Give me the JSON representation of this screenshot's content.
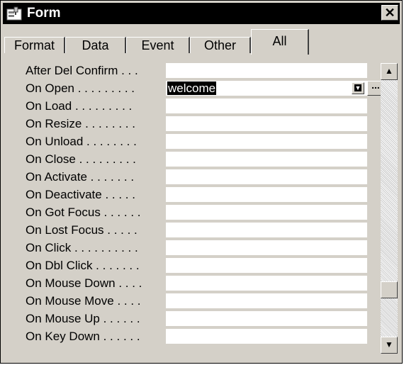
{
  "window": {
    "title": "Form",
    "title_icon": "form-properties-icon",
    "close_glyph": "✕"
  },
  "tabs": [
    {
      "label": "Format",
      "active": false
    },
    {
      "label": "Data",
      "active": false
    },
    {
      "label": "Event",
      "active": false
    },
    {
      "label": "Other",
      "active": false
    },
    {
      "label": "All",
      "active": true
    }
  ],
  "properties": [
    {
      "label": "After Del Confirm . . .",
      "value": ""
    },
    {
      "label": "On Open . . . . . . . . .",
      "value": "welcome"
    },
    {
      "label": "On Load . . . . . . . . .",
      "value": ""
    },
    {
      "label": "On Resize . . . . . . . .",
      "value": ""
    },
    {
      "label": "On Unload . . . . . . . .",
      "value": ""
    },
    {
      "label": "On Close . . . . . . . . .",
      "value": ""
    },
    {
      "label": "On Activate . . . . . . .",
      "value": ""
    },
    {
      "label": "On Deactivate . . . . .",
      "value": ""
    },
    {
      "label": "On Got Focus . . . . . .",
      "value": ""
    },
    {
      "label": "On Lost Focus . . . . .",
      "value": ""
    },
    {
      "label": "On Click . . . . . . . . . .",
      "value": ""
    },
    {
      "label": "On Dbl Click . . . . . . .",
      "value": ""
    },
    {
      "label": "On Mouse Down . . . .",
      "value": ""
    },
    {
      "label": "On Mouse Move . . . .",
      "value": ""
    },
    {
      "label": "On Mouse Up . . . . . .",
      "value": ""
    },
    {
      "label": "On Key Down . . . . . .",
      "value": ""
    }
  ],
  "selected_field": {
    "row": 1,
    "dropdown_glyph": "▼",
    "builder_glyph": "..."
  },
  "scrollbar": {
    "up_glyph": "▲",
    "down_glyph": "▼"
  }
}
